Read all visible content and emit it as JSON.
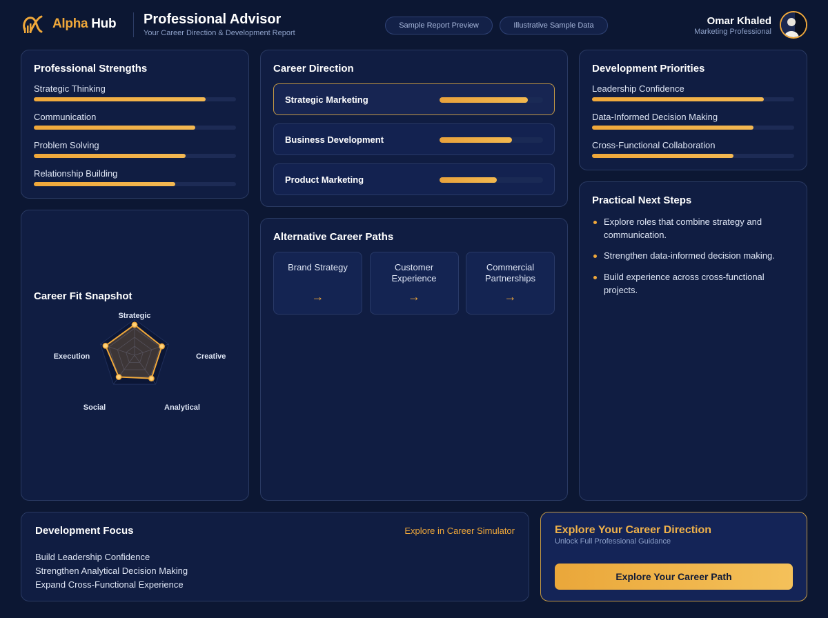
{
  "header": {
    "brand_accent": "Alpha",
    "brand_name": "Hub",
    "title": "Professional Advisor",
    "subtitle": "Your Career Direction & Development Report",
    "pills": [
      "Sample Report Preview",
      "Illustrative Sample Data"
    ],
    "user_name": "Omar Khaled",
    "user_role": "Marketing Professional"
  },
  "colors": {
    "accent": "#f0a83a",
    "background": "#0c1733",
    "card": "#101d42",
    "track": "#1d2b55"
  },
  "strengths": {
    "title": "Professional Strengths",
    "items": [
      {
        "label": "Strategic Thinking",
        "level": 0.85
      },
      {
        "label": "Communication",
        "level": 0.8
      },
      {
        "label": "Problem Solving",
        "level": 0.75
      },
      {
        "label": "Relationship Building",
        "level": 0.7
      }
    ]
  },
  "career_direction": {
    "title": "Career Direction",
    "items": [
      {
        "label": "Strategic Marketing",
        "level": 0.85,
        "active": true
      },
      {
        "label": "Business Development",
        "level": 0.7,
        "active": false
      },
      {
        "label": "Product Marketing",
        "level": 0.55,
        "active": false
      }
    ]
  },
  "development_priorities": {
    "title": "Development Priorities",
    "items": [
      {
        "label": "Leadership Confidence",
        "level": 0.85
      },
      {
        "label": "Data-Informed Decision Making",
        "level": 0.8
      },
      {
        "label": "Cross-Functional Collaboration",
        "level": 0.7
      }
    ]
  },
  "career_fit": {
    "title": "Career Fit Snapshot"
  },
  "alternative_paths": {
    "title": "Alternative Career Paths",
    "items": [
      "Brand Strategy",
      "Customer Experience",
      "Commercial Partnerships"
    ],
    "arrow": "→"
  },
  "next_steps": {
    "title": "Practical Next Steps",
    "items": [
      "Explore roles that combine strategy and communication.",
      "Strengthen data-informed decision making.",
      "Build experience across cross-functional projects."
    ]
  },
  "development_focus": {
    "title": "Development Focus",
    "link": "Explore in Career Simulator",
    "items": [
      "Build Leadership Confidence",
      "Strengthen Analytical Decision Making",
      "Expand Cross-Functional Experience"
    ]
  },
  "cta": {
    "title": "Explore Your Career Direction",
    "subtitle": "Unlock Full Professional Guidance",
    "button": "Explore Your Career Path"
  },
  "chart_data": {
    "type": "radar",
    "axes": [
      "Strategic",
      "Creative",
      "Analytical",
      "Social",
      "Execution"
    ],
    "values": [
      0.85,
      0.8,
      0.8,
      0.75,
      0.85
    ],
    "range": [
      0,
      1
    ],
    "rings": 4
  }
}
